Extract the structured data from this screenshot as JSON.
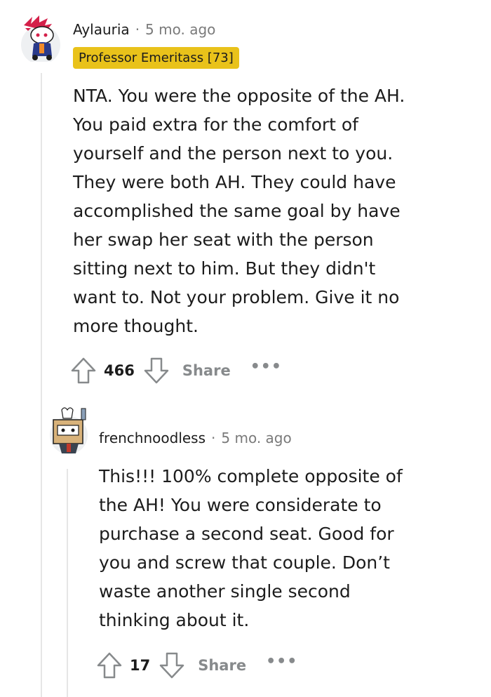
{
  "comments": [
    {
      "username": "Aylauria",
      "separator": "·",
      "time": "5 mo. ago",
      "flair": "Professor Emeritass [73]",
      "body": "NTA. You were the opposite of the AH.\nYou paid extra for the comfort of\nyourself and the person next to you.\nThey were both AH. They could have\naccomplished the same goal by have\nher swap her seat with the person\nsitting next to him. But they didn't\nwant to. Not your problem. Give it no\nmore thought.",
      "votes": "466",
      "share": "Share",
      "more": "•••"
    },
    {
      "username": "frenchnoodless",
      "separator": "·",
      "time": "5 mo. ago",
      "body": "This!!! 100% complete opposite of\nthe AH! You were considerate to\npurchase a second seat. Good for\nyou and screw that couple. Don’t\nwaste another single second\nthinking about it.",
      "votes": "17",
      "share": "Share",
      "more": "•••"
    }
  ],
  "icons": {
    "upvote": "upvote-arrow-icon",
    "downvote": "downvote-arrow-icon",
    "more": "more-options-icon"
  },
  "colors": {
    "flair_bg": "#e9c21a",
    "muted": "#878a8c",
    "thread_line": "#e6e6e6"
  }
}
